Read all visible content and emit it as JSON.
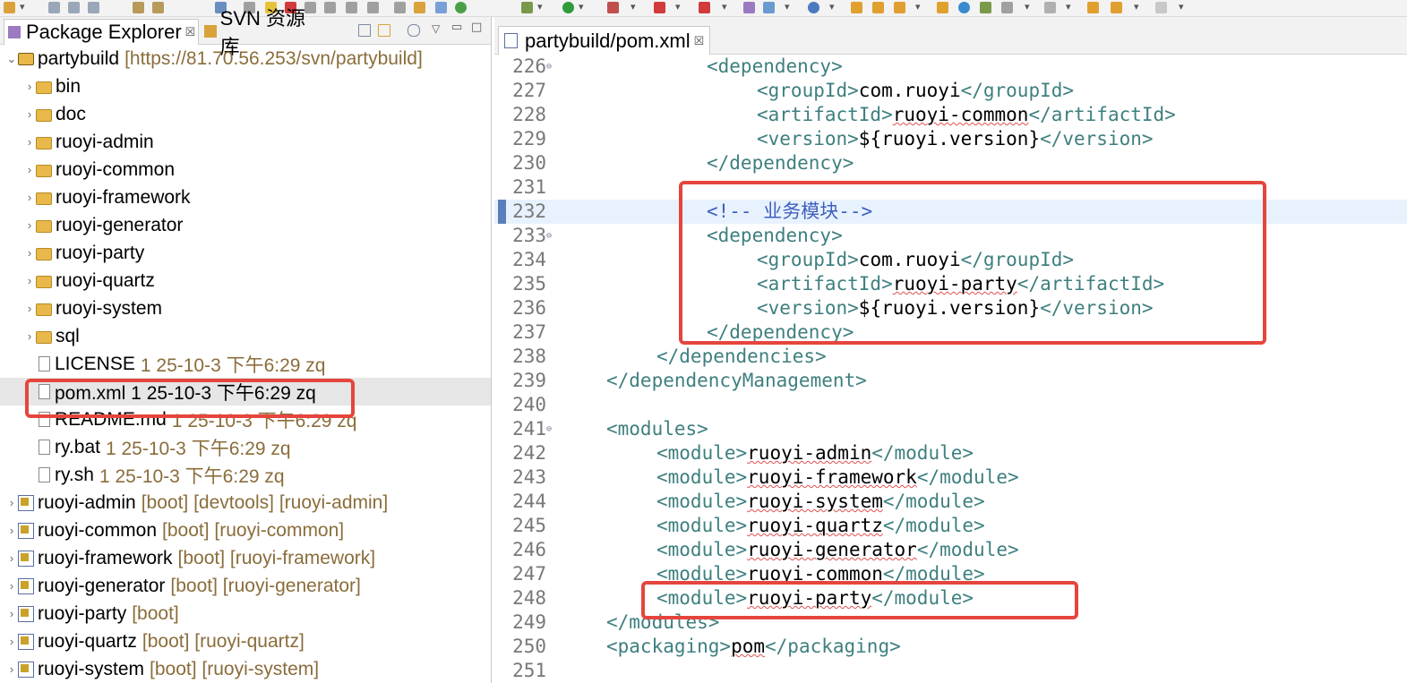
{
  "left_panel": {
    "tabs": [
      {
        "label": "Package Explorer",
        "close": "☒"
      },
      {
        "label": "SVN 资源库"
      }
    ],
    "tree": [
      {
        "label": "partybuild",
        "meta": "[https://81.70.56.253/svn/partybuild]",
        "icon": "project-icon",
        "depth": 0,
        "expanded": true
      },
      {
        "label": "bin",
        "meta": "",
        "icon": "folder-icon",
        "depth": 1
      },
      {
        "label": "doc",
        "meta": "",
        "icon": "folder-icon",
        "depth": 1
      },
      {
        "label": "ruoyi-admin",
        "meta": "",
        "icon": "folder-icon",
        "depth": 1
      },
      {
        "label": "ruoyi-common",
        "meta": "",
        "icon": "folder-icon",
        "depth": 1
      },
      {
        "label": "ruoyi-framework",
        "meta": "",
        "icon": "folder-icon",
        "depth": 1
      },
      {
        "label": "ruoyi-generator",
        "meta": "",
        "icon": "folder-icon",
        "depth": 1
      },
      {
        "label": "ruoyi-party",
        "meta": "",
        "icon": "folder-icon",
        "depth": 1
      },
      {
        "label": "ruoyi-quartz",
        "meta": "",
        "icon": "folder-icon",
        "depth": 1
      },
      {
        "label": "ruoyi-system",
        "meta": "",
        "icon": "folder-icon",
        "depth": 1
      },
      {
        "label": "sql",
        "meta": "",
        "icon": "folder-icon",
        "depth": 1
      },
      {
        "label": "LICENSE",
        "meta": "1  25-10-3 下午6:29  zq",
        "icon": "file-icon",
        "depth": 1,
        "leaf": true
      },
      {
        "label": "pom.xml 1  25-10-3 下午6:29  zq",
        "meta": "",
        "icon": "file-icon",
        "depth": 1,
        "leaf": true,
        "selected": true
      },
      {
        "label": "README.md",
        "meta": "1  25-10-3 下午6:29  zq",
        "icon": "file-icon",
        "depth": 1,
        "leaf": true
      },
      {
        "label": "ry.bat",
        "meta": "1  25-10-3 下午6:29  zq",
        "icon": "file-icon",
        "depth": 1,
        "leaf": true
      },
      {
        "label": "ry.sh",
        "meta": "1  25-10-3 下午6:29  zq",
        "icon": "file-icon",
        "depth": 1,
        "leaf": true
      },
      {
        "label": "ruoyi-admin",
        "meta": "[boot] [devtools] [ruoyi-admin]",
        "icon": "maven-project-icon",
        "depth": 0
      },
      {
        "label": "ruoyi-common",
        "meta": "[boot] [ruoyi-common]",
        "icon": "maven-project-icon",
        "depth": 0
      },
      {
        "label": "ruoyi-framework",
        "meta": "[boot] [ruoyi-framework]",
        "icon": "maven-project-icon",
        "depth": 0
      },
      {
        "label": "ruoyi-generator",
        "meta": "[boot] [ruoyi-generator]",
        "icon": "maven-project-icon",
        "depth": 0
      },
      {
        "label": "ruoyi-party",
        "meta": "[boot]",
        "icon": "maven-project-icon",
        "depth": 0
      },
      {
        "label": "ruoyi-quartz",
        "meta": "[boot] [ruoyi-quartz]",
        "icon": "maven-project-icon",
        "depth": 0
      },
      {
        "label": "ruoyi-system",
        "meta": "[boot] [ruoyi-system]",
        "icon": "maven-project-icon",
        "depth": 0
      }
    ]
  },
  "editor": {
    "tab_label": "partybuild/pom.xml",
    "tab_close": "☒",
    "current_line": 232,
    "lines": [
      {
        "n": "226",
        "indent": 2,
        "fold": true,
        "parts": [
          [
            "tg",
            "<dependency>"
          ]
        ]
      },
      {
        "n": "227",
        "indent": 3,
        "parts": [
          [
            "tg",
            "<groupId>"
          ],
          [
            "tx",
            "com.ruoyi"
          ],
          [
            "tg",
            "</groupId>"
          ]
        ]
      },
      {
        "n": "228",
        "indent": 3,
        "parts": [
          [
            "tg",
            "<artifactId>"
          ],
          [
            "sq",
            "ruoyi-common"
          ],
          [
            "tg",
            "</artifactId>"
          ]
        ]
      },
      {
        "n": "229",
        "indent": 3,
        "parts": [
          [
            "tg",
            "<version>"
          ],
          [
            "tx",
            "${ruoyi.version}"
          ],
          [
            "tg",
            "</version>"
          ]
        ]
      },
      {
        "n": "230",
        "indent": 2,
        "parts": [
          [
            "tg",
            "</dependency>"
          ]
        ]
      },
      {
        "n": "231",
        "indent": 0,
        "parts": []
      },
      {
        "n": "232",
        "indent": 2,
        "parts": [
          [
            "cm",
            "<!-- 业务模块-->"
          ]
        ]
      },
      {
        "n": "233",
        "indent": 2,
        "fold": true,
        "parts": [
          [
            "tg",
            "<dependency>"
          ]
        ]
      },
      {
        "n": "234",
        "indent": 3,
        "parts": [
          [
            "tg",
            "<groupId>"
          ],
          [
            "tx",
            "com.ruoyi"
          ],
          [
            "tg",
            "</groupId>"
          ]
        ]
      },
      {
        "n": "235",
        "indent": 3,
        "parts": [
          [
            "tg",
            "<artifactId>"
          ],
          [
            "sq",
            "ruoyi-party"
          ],
          [
            "tg",
            "</artifactId>"
          ]
        ]
      },
      {
        "n": "236",
        "indent": 3,
        "parts": [
          [
            "tg",
            "<version>"
          ],
          [
            "tx",
            "${ruoyi.version}"
          ],
          [
            "tg",
            "</version>"
          ]
        ]
      },
      {
        "n": "237",
        "indent": 2,
        "parts": [
          [
            "tg",
            "</dependency>"
          ]
        ]
      },
      {
        "n": "238",
        "indent": 1,
        "parts": [
          [
            "tg",
            "</dependencies>"
          ]
        ]
      },
      {
        "n": "239",
        "indent": 0,
        "parts": [
          [
            "tg",
            "</dependencyManagement>"
          ]
        ]
      },
      {
        "n": "240",
        "indent": 0,
        "parts": []
      },
      {
        "n": "241",
        "indent": 0,
        "fold": true,
        "parts": [
          [
            "tg",
            "<modules>"
          ]
        ]
      },
      {
        "n": "242",
        "indent": 1,
        "parts": [
          [
            "tg",
            "<module>"
          ],
          [
            "sq",
            "ruoyi-admin"
          ],
          [
            "tg",
            "</module>"
          ]
        ]
      },
      {
        "n": "243",
        "indent": 1,
        "parts": [
          [
            "tg",
            "<module>"
          ],
          [
            "sq",
            "ruoyi-framework"
          ],
          [
            "tg",
            "</module>"
          ]
        ]
      },
      {
        "n": "244",
        "indent": 1,
        "parts": [
          [
            "tg",
            "<module>"
          ],
          [
            "sq",
            "ruoyi-system"
          ],
          [
            "tg",
            "</module>"
          ]
        ]
      },
      {
        "n": "245",
        "indent": 1,
        "parts": [
          [
            "tg",
            "<module>"
          ],
          [
            "sq",
            "ruoyi-quartz"
          ],
          [
            "tg",
            "</module>"
          ]
        ]
      },
      {
        "n": "246",
        "indent": 1,
        "parts": [
          [
            "tg",
            "<module>"
          ],
          [
            "sq",
            "ruoyi-generator"
          ],
          [
            "tg",
            "</module>"
          ]
        ]
      },
      {
        "n": "247",
        "indent": 1,
        "parts": [
          [
            "tg",
            "<module>"
          ],
          [
            "sq",
            "ruoyi-common"
          ],
          [
            "tg",
            "</module>"
          ]
        ]
      },
      {
        "n": "248",
        "indent": 1,
        "parts": [
          [
            "tg",
            "<module>"
          ],
          [
            "sq",
            "ruoyi-party"
          ],
          [
            "tg",
            "</module>"
          ]
        ]
      },
      {
        "n": "249",
        "indent": 0,
        "parts": [
          [
            "tg",
            "</modules>"
          ]
        ]
      },
      {
        "n": "250",
        "indent": 0,
        "parts": [
          [
            "tg",
            "<packaging>"
          ],
          [
            "sq",
            "pom"
          ],
          [
            "tg",
            "</packaging>"
          ]
        ]
      },
      {
        "n": "251",
        "indent": 0,
        "parts": []
      }
    ]
  },
  "colors": {
    "annotation_red": "#e5453d",
    "xml_tag": "#3f7f7f",
    "xml_comment": "#3f5fbf",
    "decoration": "#8a6d3b"
  }
}
